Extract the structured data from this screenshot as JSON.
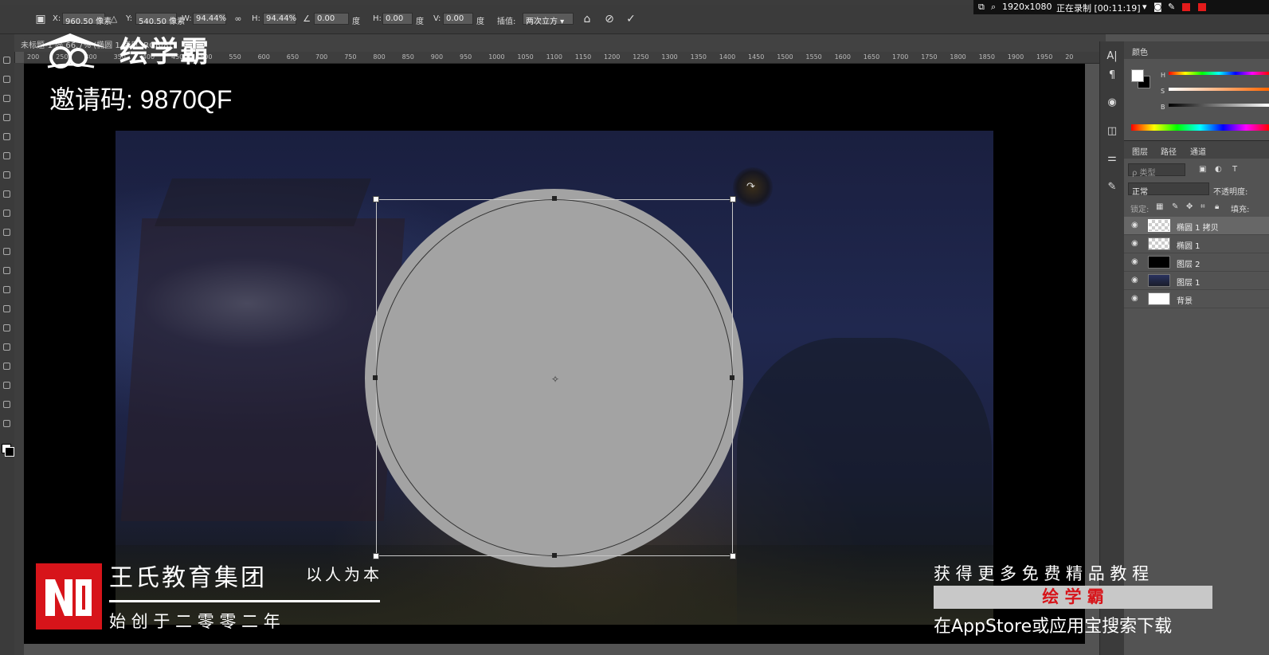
{
  "options_bar": {
    "x_label": "X:",
    "x_value": "960.50 像素",
    "y_label": "Y:",
    "y_value": "540.50 像素",
    "w_label": "W:",
    "w_value": "94.44%",
    "h_label": "H:",
    "h_value": "94.44%",
    "angle_value": "0.00",
    "angle_unit": "度",
    "hskew_label": "H:",
    "hskew_value": "0.00",
    "hskew_unit": "度",
    "vskew_label": "V:",
    "vskew_value": "0.00",
    "vskew_unit": "度",
    "interp_label": "插值:",
    "interp_value": "两次立方"
  },
  "recorder": {
    "resolution": "1920x1080",
    "status": "正在录制 [00:11:19]"
  },
  "document_tab": {
    "label": "未标题-1 @ 66.7% (椭圆 1 拷贝, RGB/8)"
  },
  "ruler_ticks": [
    "200",
    "250",
    "300",
    "350",
    "400",
    "450",
    "500",
    "550",
    "600",
    "650",
    "700",
    "750",
    "800",
    "850",
    "900",
    "950",
    "1000",
    "1050",
    "1100",
    "1150",
    "1200",
    "1250",
    "1300",
    "1350",
    "1400",
    "1450",
    "1500",
    "1550",
    "1600",
    "1650",
    "1700",
    "1750",
    "1800",
    "1850",
    "1900",
    "1950",
    "20"
  ],
  "color_panel": {
    "title": "颜色",
    "h_label": "H",
    "s_label": "S",
    "b_label": "B",
    "foreground": "#ffffff",
    "background": "#000000"
  },
  "layers_panel": {
    "tabs": [
      "图层",
      "路径",
      "通道"
    ],
    "filter_placeholder": "ρ 类型",
    "blend_mode": "正常",
    "opacity_label": "不透明度:",
    "lock_label": "锁定:",
    "fill_label": "填充:",
    "layers": [
      {
        "name": "椭圆 1 拷贝",
        "visible": true,
        "selected": true,
        "thumb": "transparent"
      },
      {
        "name": "椭圆 1",
        "visible": true,
        "selected": false,
        "thumb": "transparent"
      },
      {
        "name": "图层 2",
        "visible": true,
        "selected": false,
        "thumb": "#000000"
      },
      {
        "name": "图层 1",
        "visible": true,
        "selected": false,
        "thumb": "photo"
      },
      {
        "name": "背景",
        "visible": true,
        "selected": false,
        "thumb": "#ffffff"
      }
    ]
  },
  "watermark": {
    "brand": "绘学霸",
    "invite": "邀请码: 9870QF",
    "company": "王氏教育集团",
    "slogan": "以人为本",
    "founded": "始 创 于 二 零 零 二 年",
    "promo_line1": "获 得 更 多 免 费 精 品 教 程",
    "promo_brand": "绘 学 霸",
    "promo_line3": "在AppStore或应用宝搜索下载"
  },
  "colors": {
    "ui_dark": "#3b3b3b",
    "canvas_bg": "#000000",
    "ellipse_fill": "#a3a3a3",
    "logo_red": "#d7141a"
  }
}
